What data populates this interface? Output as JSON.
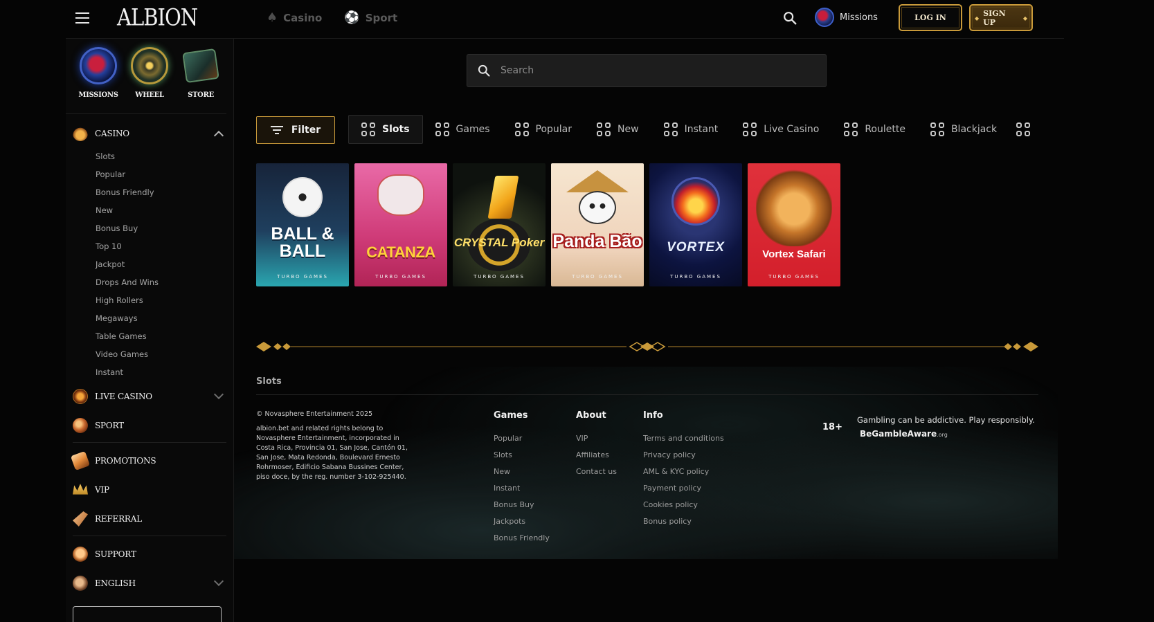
{
  "header": {
    "logo": "ALBION",
    "nav": [
      {
        "label": "Casino",
        "icon": "spade-icon"
      },
      {
        "label": "Sport",
        "icon": "ball-icon"
      }
    ],
    "missions_label": "Missions",
    "login_label": "LOG IN",
    "signup_label": "SIGN UP"
  },
  "sidebar": {
    "quick": [
      {
        "label": "MISSIONS"
      },
      {
        "label": "WHEEL"
      },
      {
        "label": "STORE"
      }
    ],
    "casino": {
      "title": "CASINO",
      "items": [
        "Slots",
        "Popular",
        "Bonus Friendly",
        "New",
        "Bonus Buy",
        "Top 10",
        "Jackpot",
        "Drops And Wins",
        "High Rollers",
        "Megaways",
        "Table Games",
        "Video Games",
        "Instant"
      ]
    },
    "live_casino": "LIVE CASINO",
    "sport": "SPORT",
    "promotions": "PROMOTIONS",
    "vip": "VIP",
    "referral": "REFERRAL",
    "support": "SUPPORT",
    "language": "ENGLISH"
  },
  "search": {
    "placeholder": "Search"
  },
  "filter_label": "Filter",
  "categories": [
    "Slots",
    "Games",
    "Popular",
    "New",
    "Instant",
    "Live Casino",
    "Roulette",
    "Blackjack"
  ],
  "games": [
    {
      "title": "BALL & BALL",
      "provider": "TURBO GAMES"
    },
    {
      "title": "CATANZA",
      "provider": "TURBO GAMES"
    },
    {
      "title": "CRYSTAL Poker",
      "provider": "TURBO GAMES"
    },
    {
      "title": "Panda Bão",
      "provider": "TURBO GAMES"
    },
    {
      "title": "VORTEX",
      "provider": "TURBO GAMES"
    },
    {
      "title": "Vortex Safari",
      "provider": "TURBO GAMES"
    }
  ],
  "footer": {
    "section_title": "Slots",
    "copyright": "© Novasphere Entertainment 2025",
    "legal": "albion.bet and related rights belong to Novasphere Entertainment, incorporated in Costa Rica, Provincia 01, San Jose, Cantón 01, San Jose, Mata Redonda, Boulevard Ernesto Rohrmoser, Edificio Sabana Bussines Center, piso doce, by the reg. number 3-102-925440.",
    "games_title": "Games",
    "games_links": [
      "Popular",
      "Slots",
      "New",
      "Instant",
      "Bonus Buy",
      "Jackpots",
      "Bonus Friendly"
    ],
    "about_title": "About",
    "about_links": [
      "VIP",
      "Affiliates",
      "Contact us"
    ],
    "info_title": "Info",
    "info_links": [
      "Terms and conditions",
      "Privacy policy",
      "AML & KYC policy",
      "Payment policy",
      "Cookies policy",
      "Bonus policy"
    ],
    "age": "18+",
    "warning": "Gambling can be addictive. Play responsibly.",
    "aware_bold": "BeGamble",
    "aware_rest": "Aware",
    "aware_suffix": ".org"
  },
  "colors": {
    "accent_gold": "#c99a3a",
    "background": "#050505"
  }
}
